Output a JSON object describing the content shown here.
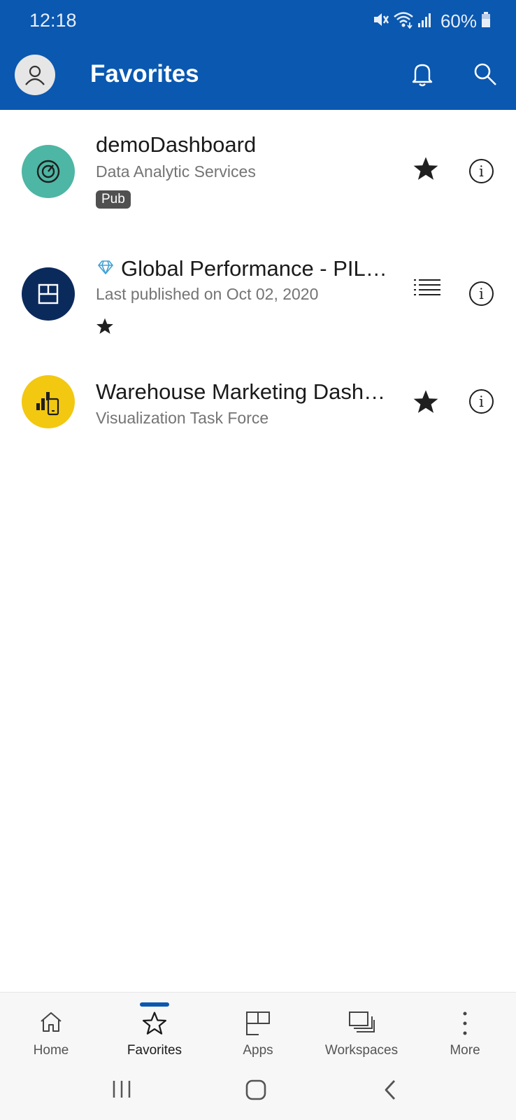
{
  "status_bar": {
    "time": "12:18",
    "battery": "60%"
  },
  "app_bar": {
    "title": "Favorites"
  },
  "items": [
    {
      "title": "demoDashboard",
      "subtitle": "Data Analytic Services",
      "badge": "Pub",
      "icon": "gauge-icon",
      "color": "#4db6a4"
    },
    {
      "title": "Global Performance - PIL…",
      "subtitle": "Last published on Oct 02, 2020",
      "icon": "app-icon",
      "color": "#0b2a5c"
    },
    {
      "title": "Warehouse Marketing Dash…",
      "subtitle": "Visualization Task Force",
      "icon": "mobile-report-icon",
      "color": "#f2c811"
    }
  ],
  "bottom_nav": {
    "items": [
      {
        "label": "Home"
      },
      {
        "label": "Favorites"
      },
      {
        "label": "Apps"
      },
      {
        "label": "Workspaces"
      },
      {
        "label": "More"
      }
    ]
  },
  "colors": {
    "brand": "#0a58b0"
  }
}
